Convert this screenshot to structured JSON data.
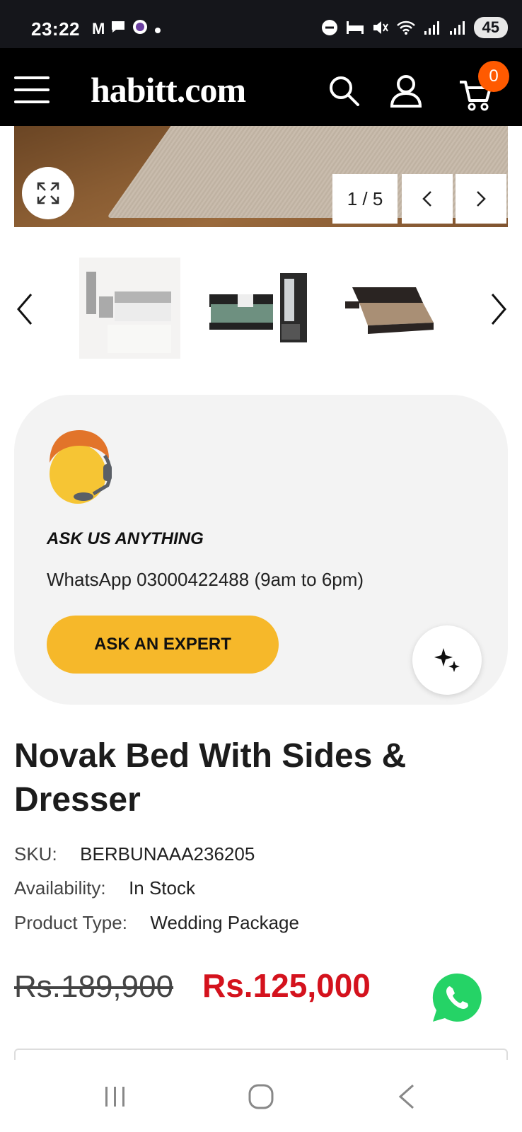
{
  "status_bar": {
    "time": "23:22",
    "battery": "45"
  },
  "header": {
    "logo": "habitt.com",
    "cart_count": "0"
  },
  "gallery": {
    "counter": "1 / 5"
  },
  "ask_card": {
    "title": "ASK US ANYTHING",
    "subtitle": "WhatsApp 03000422488 (9am to 6pm)",
    "button": "ASK AN EXPERT"
  },
  "product": {
    "title": "Novak Bed With Sides & Dresser",
    "sku_label": "SKU:",
    "sku_value": "BERBUNAAA236205",
    "availability_label": "Availability:",
    "availability_value": "In Stock",
    "type_label": "Product Type:",
    "type_value": "Wedding Package",
    "price_old": "Rs.189,900",
    "price_new": "Rs.125,000"
  },
  "colors": {
    "accent_yellow": "#f6b82a",
    "price_red": "#d4121d",
    "cart_badge": "#ff5a00",
    "whatsapp_green": "#25d366"
  }
}
